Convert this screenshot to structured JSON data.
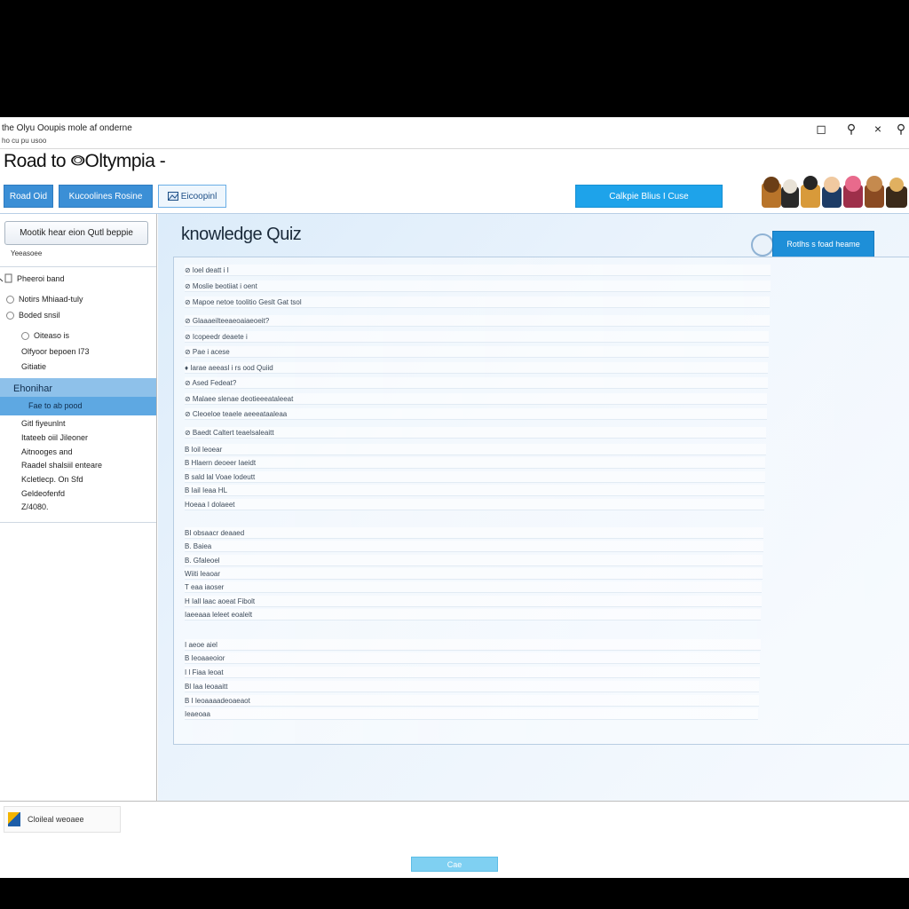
{
  "window": {
    "title": "the Olyu Ooupis mole af onderne",
    "subtitle": "ho cu pu usoo",
    "controls": [
      "◻",
      "⚲",
      "×",
      "⚲"
    ]
  },
  "app": {
    "title": "Road to ⭖Oltympia -"
  },
  "nav": {
    "btn1": "Road Oid",
    "btn2": "Kucoolines Rosine",
    "btn3": "Eicoopinl",
    "cta": "Calkpie  Blius I Cuse"
  },
  "sidebar": {
    "search_label": "Mootik hear eion Qutl beppie",
    "caption": "Yeeasoee",
    "items": [
      {
        "label": "Pheeroi band",
        "kind": "checkbox"
      },
      {
        "label": "Notirs Mhiaad-tuly",
        "kind": "radio"
      },
      {
        "label": "Boded snsil",
        "kind": "radio"
      },
      {
        "label": "Oiteaso is",
        "kind": "radio"
      },
      {
        "label": "Olfyoor bepoen I73",
        "kind": "checkbox"
      },
      {
        "label": "Gitiatie",
        "kind": "plain"
      }
    ],
    "active_title": "Ehonihar",
    "active_sub": "Fae to ab pood",
    "text_lines": [
      "Gitl fiyeunlnt",
      "Itateeb oiil Jileoner",
      "Aitnooges and",
      "Raadel shalsiil enteare",
      "Kcletlecp. On Sfd",
      "Geldeofenfd",
      "Z/4080."
    ]
  },
  "main": {
    "title": "knowledge Quiz",
    "action_label": "Rotlhs s foad heame",
    "questions": [
      "⊘  loel deatt i I",
      "⊘  Moslie beotiiat i oent",
      "⊘  Mapoe netoe toolitio Geslt Gat tsol",
      "⊘  Glaaaeilteeaeoaiaeoeit?",
      "⊘  Icopeedr deaete i",
      "⊘  Pae i acese",
      "♦  Iarae aeeasl i rs ood Quiid",
      "⊘  Ased Fedeat?",
      "⊘  Malaee slenae deotieeeataleeat",
      "⊘  Cleoeloe teaele aeeeataaleaa",
      "⊘  Baedt Caltert teaelsaleaitt",
      "B  Ioil leoear",
      "B  Hlaern deoeer Iaeidt",
      "B  sald lal Voae lodeutt",
      "B  Iail Ieaa HL",
      "Hoeaa I dolaeet",
      "BI obsaacr deaaed",
      "B. Baiea",
      "B. Gfaleoel",
      "Wiiti Ieaoar",
      "T eaa iaoser",
      "H Iall laac aoeat Fibolt",
      "Iaeeaaa leleet eoalelt",
      "I aeoe aiel",
      "B Ieoaaeoior",
      "I l Fiaa leoat",
      "Bl Iaa leoaaitt",
      "B I leoaaaadeoaeaot",
      "Ieaeoaa"
    ]
  },
  "footer": {
    "status": "Cloileal weoaee",
    "close_label": "Cae"
  }
}
